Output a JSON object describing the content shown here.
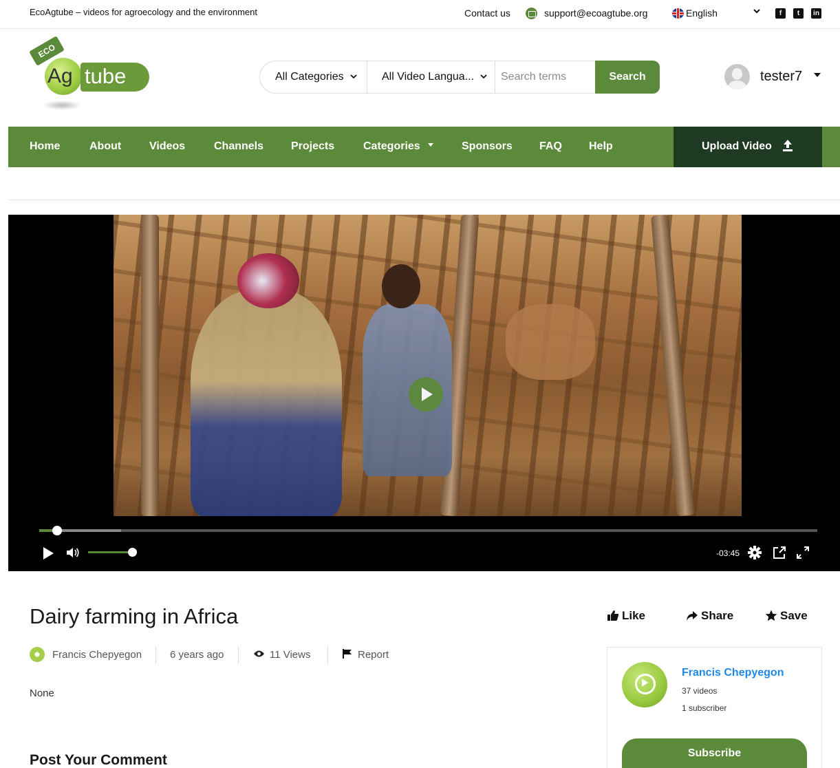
{
  "topbar": {
    "tagline": "EcoAgtube – videos for agroecology and the environment",
    "contact_label": "Contact us",
    "email": "support@ecoagtube.org",
    "language": "English",
    "social": [
      "facebook-icon",
      "twitter-icon",
      "linkedin-icon"
    ]
  },
  "logo": {
    "eco": "ECO",
    "ag": "Ag",
    "tube": "tube"
  },
  "search": {
    "category": "All Categories",
    "video_language": "All Video Langua...",
    "placeholder": "Search terms",
    "button": "Search"
  },
  "user": {
    "name": "tester7"
  },
  "nav": {
    "items": [
      "Home",
      "About",
      "Videos",
      "Channels",
      "Projects",
      "Categories",
      "Sponsors",
      "FAQ",
      "Help"
    ],
    "upload": "Upload Video"
  },
  "player": {
    "time_remaining": "-03:45",
    "progress": 0.023,
    "buffered": 0.105,
    "volume": 1.0
  },
  "video": {
    "title": "Dairy farming in Africa",
    "channel": "Francis Chepyegon",
    "age": "6 years ago",
    "views": "11 Views",
    "report": "Report",
    "description": "None"
  },
  "actions": {
    "like": "Like",
    "share": "Share",
    "save": "Save"
  },
  "channel_card": {
    "name": "Francis Chepyegon",
    "videos": "37 videos",
    "subscribers": "1 subscriber",
    "subscribe": "Subscribe"
  },
  "comments": {
    "heading": "Post Your Comment"
  },
  "colors": {
    "brand_green": "#5b8a3a",
    "dark_green": "#1f3a22",
    "link_blue": "#1e88e5"
  }
}
